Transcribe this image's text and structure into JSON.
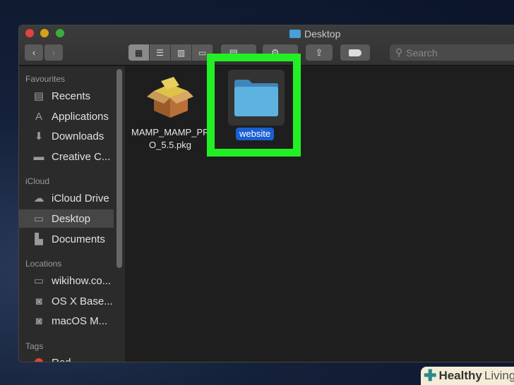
{
  "window": {
    "title": "Desktop"
  },
  "toolbar": {
    "search_placeholder": "Search",
    "back": "‹",
    "forward": "›"
  },
  "sidebar": {
    "sections": [
      {
        "label": "Favourites",
        "items": [
          {
            "label": "Recents",
            "icon": "recents-icon"
          },
          {
            "label": "Applications",
            "icon": "applications-icon"
          },
          {
            "label": "Downloads",
            "icon": "downloads-icon"
          },
          {
            "label": "Creative C...",
            " icon": "folder-icon"
          }
        ]
      },
      {
        "label": "iCloud",
        "items": [
          {
            "label": "iCloud Drive"
          },
          {
            "label": "Desktop",
            "selected": true
          },
          {
            "label": "Documents"
          }
        ]
      },
      {
        "label": "Locations",
        "items": [
          {
            "label": "wikihow.co..."
          },
          {
            "label": "OS X Base..."
          },
          {
            "label": "macOS M..."
          }
        ]
      },
      {
        "label": "Tags",
        "items": [
          {
            "label": "Red",
            "color": "#e0443e"
          }
        ]
      }
    ]
  },
  "files": [
    {
      "name_line1": "MAMP_MAMP_PR",
      "name_line2": "O_5.5.pkg"
    },
    {
      "name": "website",
      "selected": true
    }
  ],
  "watermark": {
    "text_bold": "Healthy",
    "text": "Living"
  },
  "colors": {
    "highlight": "#22f024",
    "selection": "#1a5fd0"
  }
}
